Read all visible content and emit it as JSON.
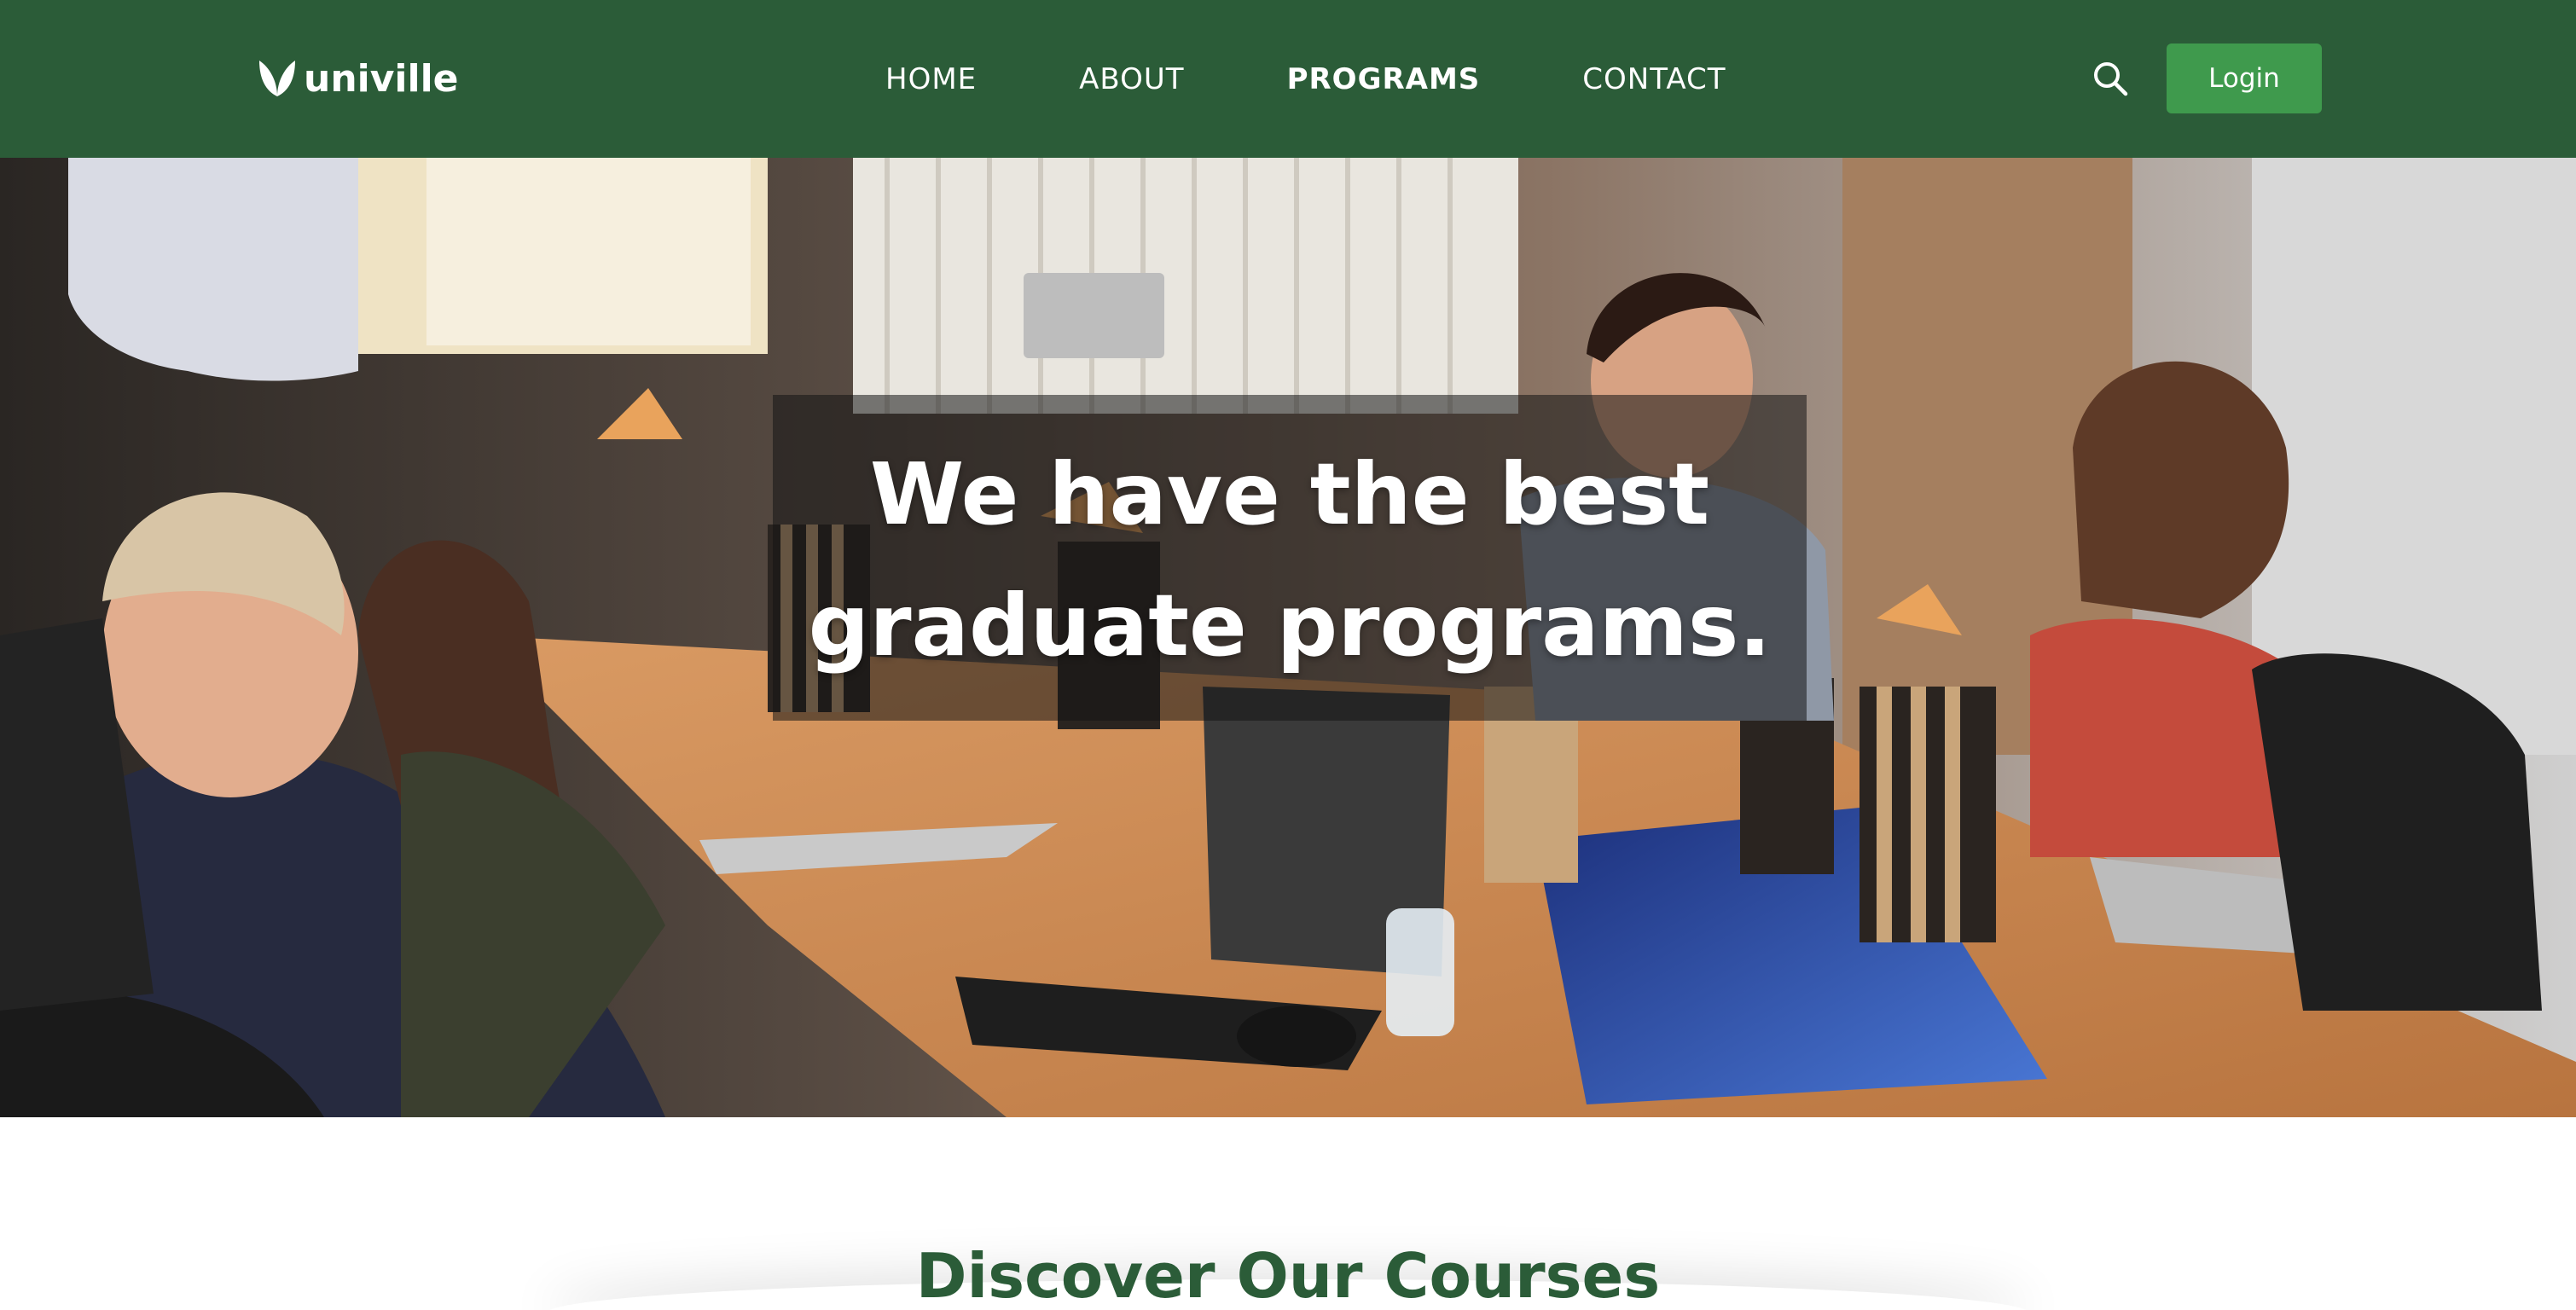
{
  "header": {
    "logo_text": "univille",
    "nav": [
      {
        "label": "HOME",
        "active": false
      },
      {
        "label": "ABOUT",
        "active": false
      },
      {
        "label": "PROGRAMS",
        "active": true
      },
      {
        "label": "CONTACT",
        "active": false
      }
    ],
    "search_icon": "search-icon",
    "login_label": "Login"
  },
  "hero": {
    "title_line1": "We have the best",
    "title_line2": "graduate programs."
  },
  "section": {
    "title": "Discover Our Courses"
  },
  "colors": {
    "header_bg": "#2b5c38",
    "login_bg": "#3f9a4d",
    "section_title": "#2b5c38"
  }
}
